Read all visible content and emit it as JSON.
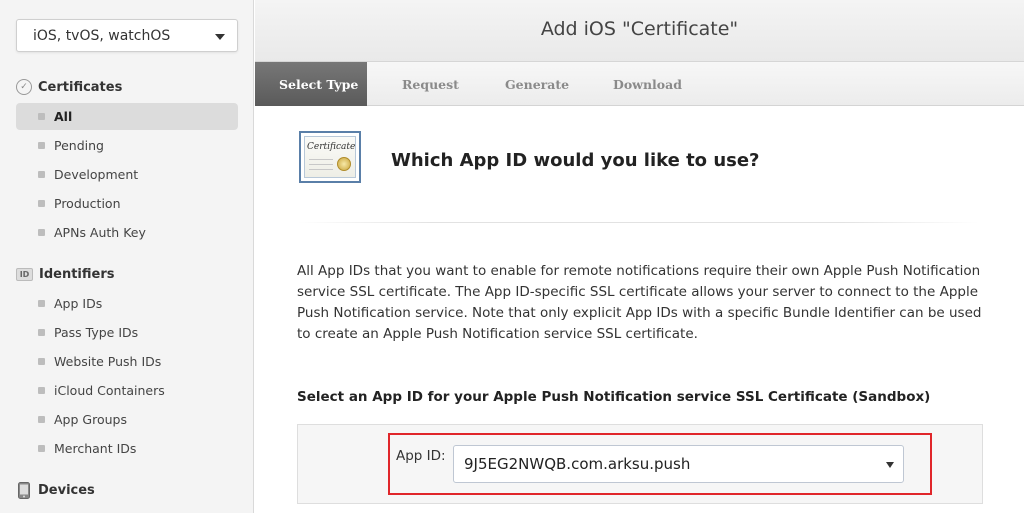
{
  "sidebar": {
    "platform_select": "iOS, tvOS, watchOS",
    "sections": {
      "certificates": {
        "title": "Certificates",
        "items": [
          "All",
          "Pending",
          "Development",
          "Production",
          "APNs Auth Key"
        ]
      },
      "identifiers": {
        "title": "Identifiers",
        "icon_text": "ID",
        "items": [
          "App IDs",
          "Pass Type IDs",
          "Website Push IDs",
          "iCloud Containers",
          "App Groups",
          "Merchant IDs"
        ]
      },
      "devices": {
        "title": "Devices"
      }
    },
    "active_item": "All"
  },
  "header": {
    "title": "Add iOS \"Certificate\""
  },
  "steps": [
    "Select Type",
    "Request",
    "Generate",
    "Download"
  ],
  "active_step": "Select Type",
  "main": {
    "certificate_image_text": "Certificate",
    "question": "Which App ID would you like to use?",
    "description": "All App IDs that you want to enable for remote notifications require their own Apple Push Notification service SSL certificate. The App ID-specific SSL certificate allows your server to connect to the Apple Push Notification service. Note that only explicit App IDs with a specific Bundle Identifier can be used to create an Apple Push Notification service SSL certificate.",
    "select_heading": "Select an App ID for your Apple Push Notification service SSL Certificate (Sandbox)",
    "app_id_label": "App ID:",
    "app_id_value": "9J5EG2NWQB.com.arksu.push"
  },
  "colors": {
    "highlight": "#e0262a",
    "active_step_bg": "#5a5a5a",
    "sidebar_bg": "#f4f4f4"
  }
}
